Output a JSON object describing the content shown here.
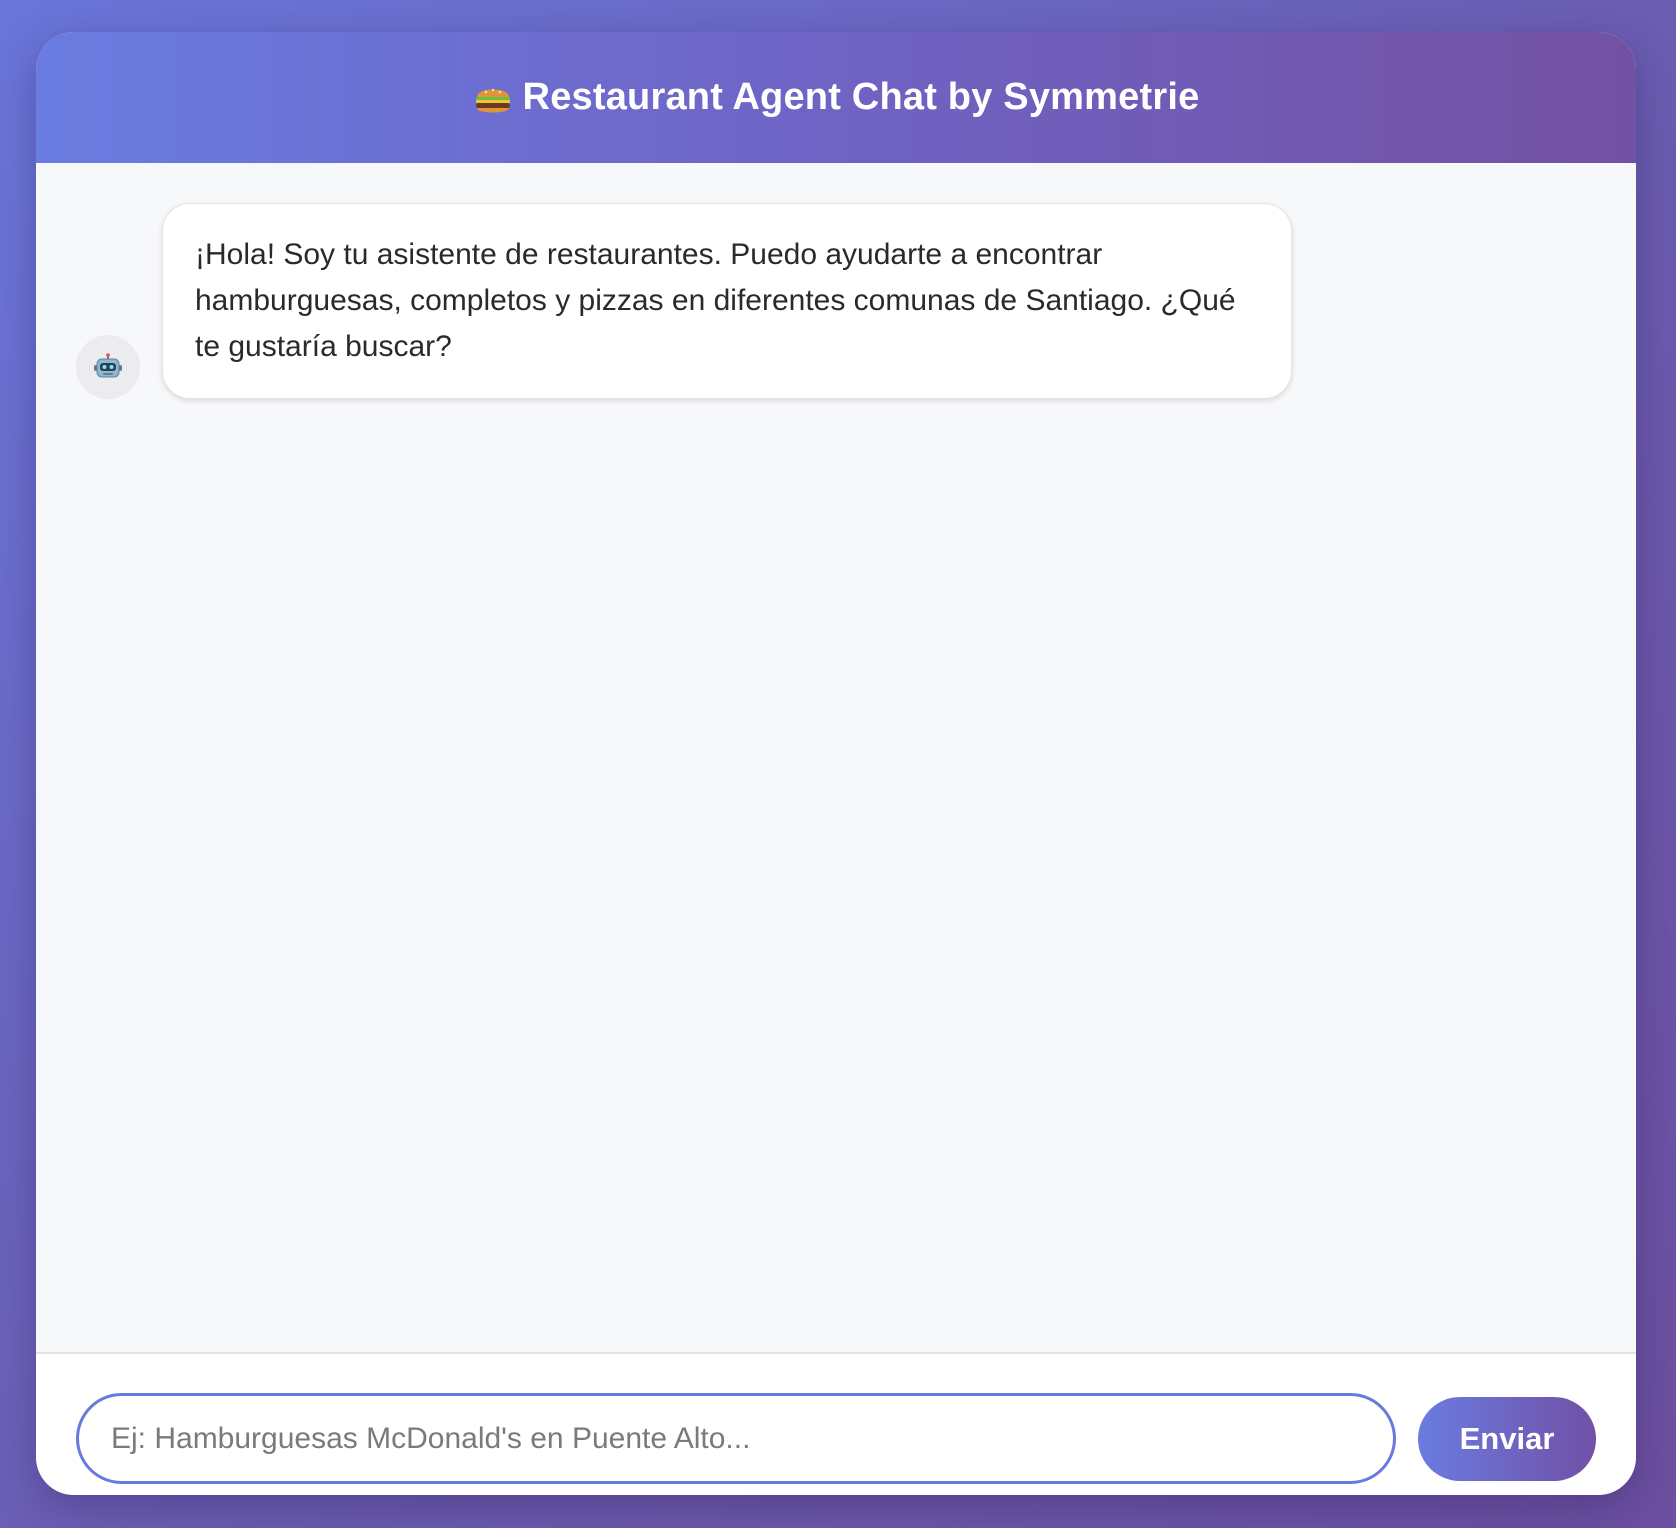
{
  "header": {
    "icon": "hamburger-icon",
    "title": "Restaurant Agent Chat by Symmetrie"
  },
  "messages": [
    {
      "sender": "bot",
      "avatar_icon": "robot-icon",
      "text": "¡Hola! Soy tu asistente de restaurantes. Puedo ayudarte a encontrar hamburguesas, completos y pizzas en diferentes comunas de Santiago. ¿Qué te gustaría buscar?"
    }
  ],
  "composer": {
    "value": "",
    "placeholder": "Ej: Hamburguesas McDonald's en Puente Alto...",
    "send_label": "Enviar"
  },
  "colors": {
    "accent_start": "#6a7ce0",
    "accent_end": "#7150a6",
    "chat_background": "#f7f8fa"
  }
}
